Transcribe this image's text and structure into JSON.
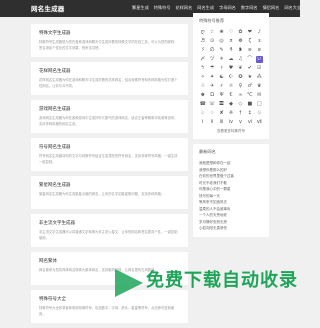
{
  "header": {
    "logo": "网名生成器",
    "nav": [
      "繁星生成",
      "特殊符号",
      "花样网名",
      "网名生成",
      "字母网名",
      "数字网名",
      "情侣网名",
      "网名大全"
    ]
  },
  "cards": [
    {
      "title": "特殊文字生成器",
      "desc": "特殊符号生成器是为您在各种游戏和聊天中生成好看的特殊文字的在线工具，可以为您的昵称、签名添加个性化的文字效果，快来试试吧。"
    },
    {
      "title": "花样网名生成器",
      "desc": "花样网名生成器为你在游戏和聊天中生成好看的花样网名，结合特殊符号和多种风格为您打造个性网名，让你与众不同。"
    },
    {
      "title": "游戏网名生成器",
      "desc": "游戏网名生成器为你在各种游戏中生成好听又霸气的游戏网名，适合王者荣耀和平精英等游戏，支持多种风格的网名生成。"
    },
    {
      "title": "符号网名生成器",
      "desc": "符号网名生成器将你的文字与特殊符号结合生成漂亮的符号网名，支持多种符号风格，一键生成一键复制。"
    },
    {
      "title": "繁星网名生成器",
      "desc": "繁星网名生成器为你生成繁星点缀的网名，让你的名字如繁星般闪耀，支持多种风格。"
    },
    {
      "title": "非主流文字生成器",
      "desc": "非主流文字生成器可以将普通文字转换为非主流火星文，让你的网名和签名更具个性，一键复制使用。"
    },
    {
      "title": "网名繁体",
      "desc": "网名繁体为您将简体网名转换为繁体网名，支持繁简互转，让网名更有古风韵味。"
    },
    {
      "title": "特殊符号大全",
      "desc": "特殊符号大全收录各种常用特殊符号，包括数字、字母、箭头、星星等符号，点击即可复制使用。"
    }
  ],
  "symbols": {
    "title": "特殊符号推荐",
    "items": [
      "ღ",
      "☆",
      "❀",
      "♡",
      "✿",
      "❤",
      "♪",
      "♬",
      "⊙",
      "◎",
      "¤",
      "❁",
      "ζ",
      "з",
      "ゞ",
      "の",
      "✎",
      "₰",
      "❥",
      "ʚ",
      "ɞ",
      "〆",
      "ヅ",
      "☀",
      "☁",
      "♫",
      "⌒",
      "ぃ",
      "ϟ",
      "☂",
      "♯",
      "♥",
      "❦",
      "✔",
      "☑",
      "✧",
      "✦",
      "☯",
      "☪",
      "✪",
      "★",
      "⁂",
      "☃",
      "✈",
      "⚡",
      "☼",
      "♀",
      "♂",
      "♛",
      "♚",
      "Ω",
      "Ψ",
      "€",
      "∞",
      "℃",
      "✉",
      "☎",
      "☏",
      "〓",
      "◆",
      "◇",
      "■",
      "□",
      "♤",
      "♢",
      "✘",
      "※",
      "†",
      "‡",
      "♧",
      "ⅰ",
      "ⅱ",
      "ⅲ",
      "ⅳ",
      "ⅴ",
      "ⅵ",
      "ⅶ"
    ],
    "selected_index": 27,
    "more": "查看更多特殊符号"
  },
  "recent": {
    "title": "最新网名",
    "items": [
      "我就是想和你在一起",
      "我想你是那么的好",
      "在你的世界里做个过客",
      "时光不老我们不散",
      "你是我心中的一颗星",
      "快乐的每一天",
      "等风来不如追风去",
      "温柔的人不会被辜负",
      "一个人的天荒地老",
      "岁月静好安然无恙",
      "心若向阳无畏悲伤"
    ]
  },
  "banner": {
    "text": "免费下载自动收录"
  }
}
